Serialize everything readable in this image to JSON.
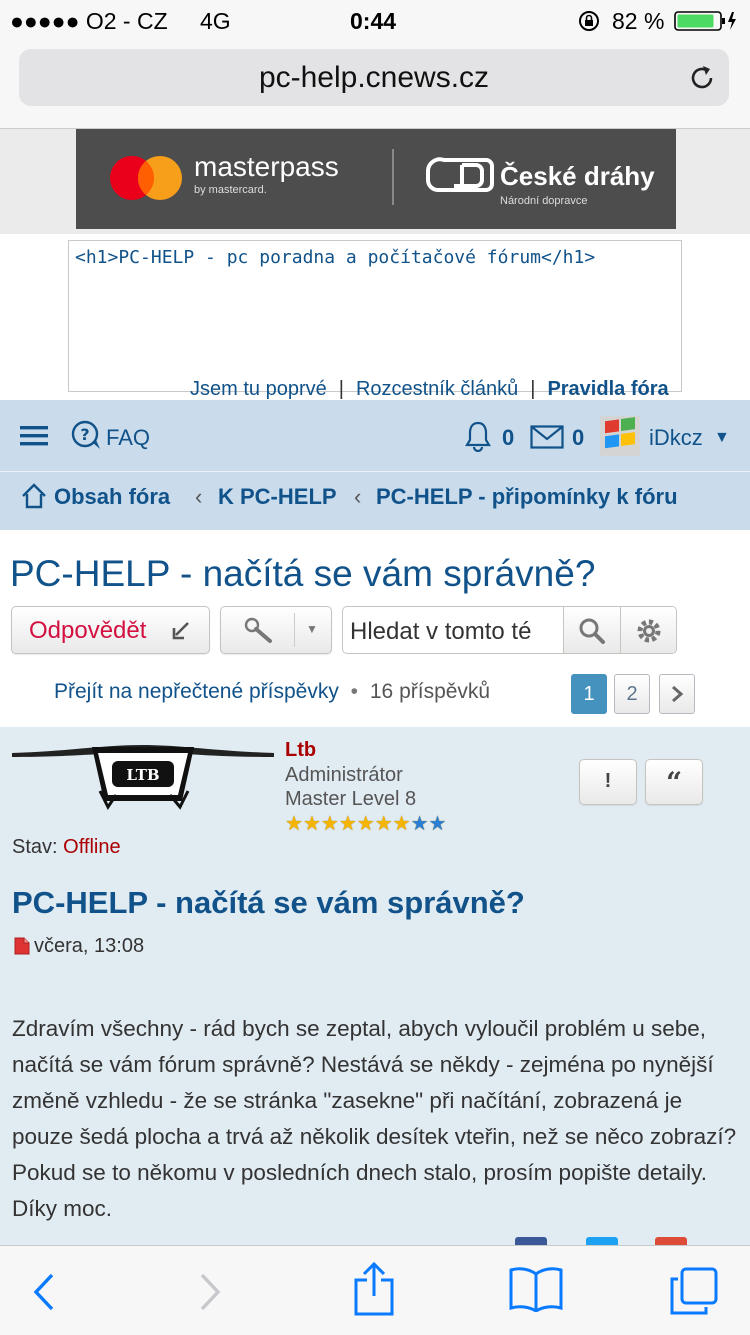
{
  "status_bar": {
    "carrier": "●●●●● O2 - CZ",
    "network": "4G",
    "time": "0:44",
    "battery": "82 %"
  },
  "browser": {
    "url": "pc-help.cnews.cz"
  },
  "ad": {
    "brand_left": "masterpass",
    "brand_left_sub": "by mastercard.",
    "brand_right": "České dráhy",
    "brand_right_sub": "Národní dopravce"
  },
  "header": {
    "h1_text": "<h1>PC-HELP - pc poradna a počítačové fórum</h1>",
    "links": [
      "Jsem tu poprvé",
      "Rozcestník článků",
      "Pravidla fóra"
    ]
  },
  "navbar": {
    "faq": "FAQ",
    "notifications": "0",
    "messages": "0",
    "username": "iDkcz"
  },
  "breadcrumbs": [
    "Obsah fóra",
    "K PC-HELP",
    "PC-HELP - připomínky k fóru"
  ],
  "topic": {
    "title": "PC-HELP - načítá se vám správně?",
    "reply_label": "Odpovědět",
    "search_placeholder": "Hledat v tomto té",
    "unread_link": "Přejít na nepřečtené příspěvky",
    "post_count": "16 příspěvků",
    "pages": [
      "1",
      "2"
    ],
    "current_page": "1"
  },
  "post": {
    "author": "Ltb",
    "role": "Administrátor",
    "level": "Master Level 8",
    "stars_total": 9,
    "stars_gold": 7,
    "status_label": "Stav:",
    "status_value": "Offline",
    "title": "PC-HELP - načítá se vám správně?",
    "date": "včera, 13:08",
    "body": "Zdravím všechny - rád bych se zeptal, abych vyloučil problém u sebe, načítá se vám fórum správně? Nestává se někdy - zejména po nynější změně vzhledu - že se stránka \"zasekne\" při načítání, zobrazená je pouze šedá plocha a trvá až několik desítek vteřin, než se něco zobrazí? Pokud se to někomu v posledních dnech stalo, prosím popište detaily. Díky moc.",
    "report_label": "!",
    "quote_label": "“"
  },
  "colors": {
    "link": "#105289",
    "navbar_bg": "#cadceb",
    "post_bg": "#e1ebf2",
    "reply": "#d31141",
    "author": "#aa0000",
    "ios_blue": "#0a7aff"
  }
}
